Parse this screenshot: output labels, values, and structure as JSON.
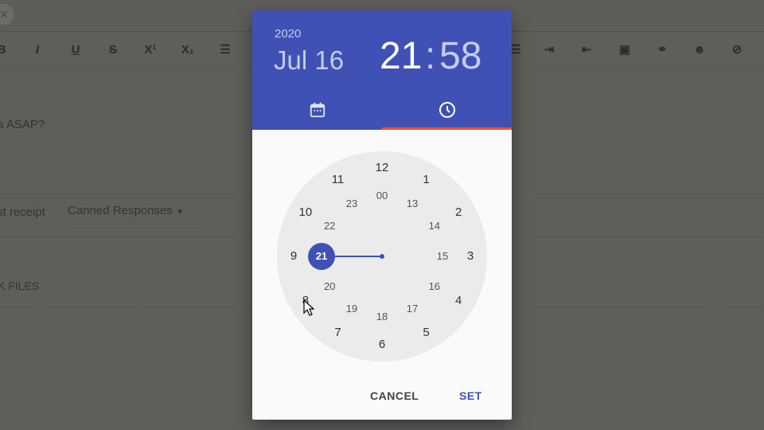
{
  "background": {
    "toolbar_icons": [
      "bold-icon",
      "italic-icon",
      "underline-icon",
      "strikethrough-icon",
      "superscript-icon",
      "subscript-icon",
      "bulleted-list-icon",
      "numbered-list-icon",
      "indent-icon",
      "outdent-icon",
      "image-icon",
      "link-icon",
      "emoji-icon",
      "clear-format-icon"
    ],
    "body_text": "s ASAP?",
    "receipt_label": "st receipt",
    "canned_responses": "Canned Responses",
    "files_label": "K FILES"
  },
  "picker": {
    "year": "2020",
    "date": "Jul 16",
    "hour": "21",
    "colon": ":",
    "minute": "58",
    "active_tab": "clock",
    "outer_numbers": [
      "12",
      "1",
      "2",
      "3",
      "4",
      "5",
      "6",
      "7",
      "8",
      "9",
      "10",
      "11"
    ],
    "inner_numbers": [
      "00",
      "13",
      "14",
      "15",
      "16",
      "17",
      "18",
      "19",
      "20",
      "21",
      "22",
      "23"
    ],
    "selected_hour": "21",
    "cancel_label": "CANCEL",
    "set_label": "SET",
    "colors": {
      "primary": "#3f51b5",
      "indicator": "#f4511e"
    }
  }
}
